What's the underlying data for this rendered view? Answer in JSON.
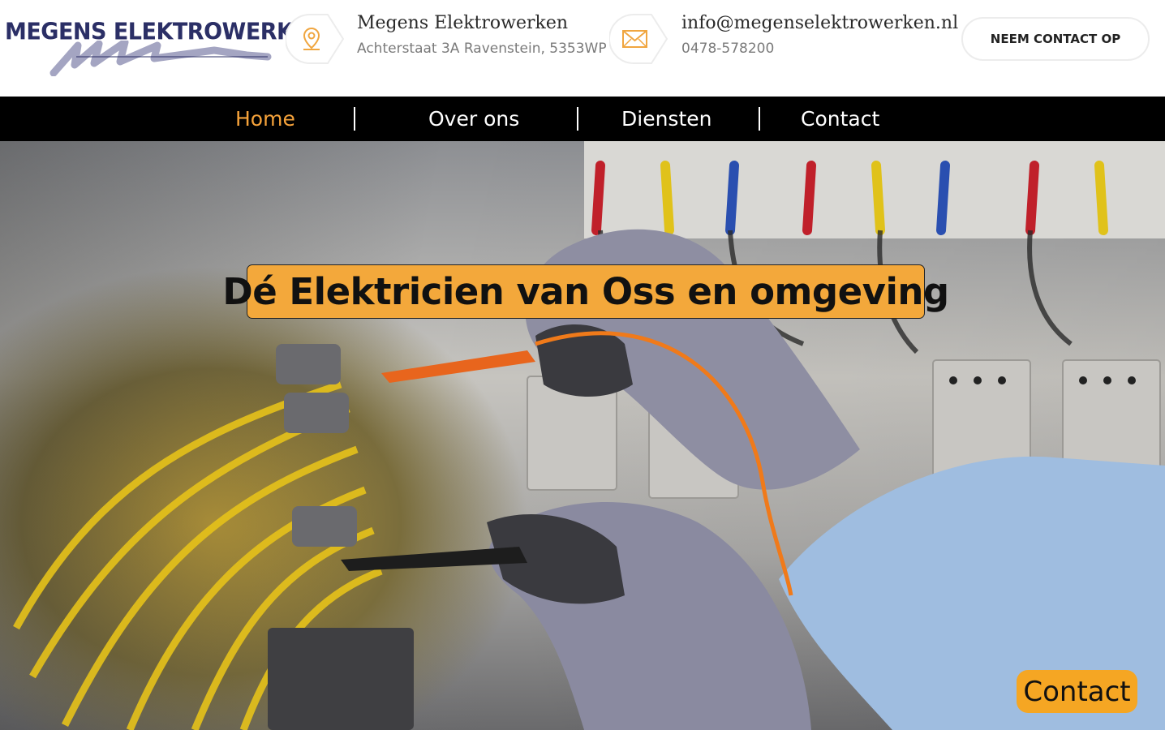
{
  "brand": {
    "logo_text": "MEGENS ELEKTROWERKEN"
  },
  "header": {
    "address": {
      "icon": "location-pin-icon",
      "title": "Megens Elektrowerken",
      "line": "Achterstaat 3A Ravenstein, 5353WP"
    },
    "contact": {
      "icon": "envelope-icon",
      "email": "info@megenselektrowerken.nl",
      "phone": "0478-578200"
    },
    "cta_label": "NEEM CONTACT OP"
  },
  "nav": {
    "items": [
      {
        "label": "Home",
        "active": true
      },
      {
        "label": "Over ons",
        "active": false
      },
      {
        "label": "Diensten",
        "active": false
      },
      {
        "label": "Contact",
        "active": false
      }
    ]
  },
  "hero": {
    "headline": "Dé Elektricien van Oss en omgeving",
    "image": "electrician-testing-panel-photo"
  },
  "floating_button": {
    "label": "Contact"
  },
  "colors": {
    "accent": "#f5a23a",
    "nav_bg": "#000000",
    "logo": "#2b2f66",
    "icon": "#f0a640"
  }
}
